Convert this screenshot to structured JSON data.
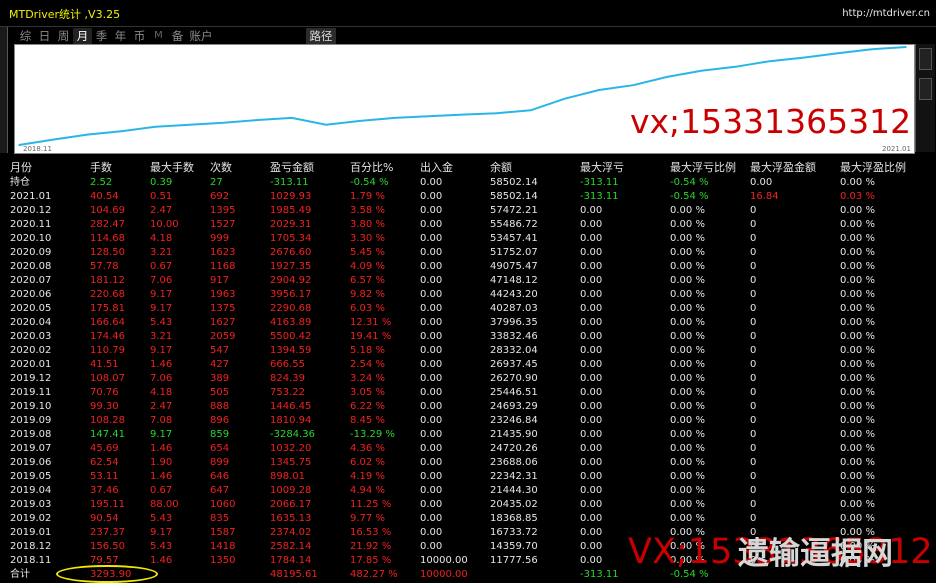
{
  "app": {
    "title": "MTDriver统计 ,V3.25",
    "url": "http://mtdriver.cn"
  },
  "tabs": [
    {
      "label": "综",
      "active": false
    },
    {
      "label": "日",
      "active": false
    },
    {
      "label": "周",
      "active": false
    },
    {
      "label": "月",
      "active": true
    },
    {
      "label": "季",
      "active": false
    },
    {
      "label": "年",
      "active": false
    },
    {
      "label": "币",
      "active": false
    },
    {
      "label": "M",
      "active": false
    },
    {
      "label": "备",
      "active": false
    },
    {
      "label": "账户",
      "active": false
    }
  ],
  "route_button": "路径",
  "chart_data": {
    "type": "line",
    "xlabel_start": "2018.11",
    "xlabel_end": "2021.01",
    "line_color": "#29b6e6",
    "x": [
      "2018.11",
      "2018.12",
      "2019.01",
      "2019.02",
      "2019.03",
      "2019.04",
      "2019.05",
      "2019.06",
      "2019.07",
      "2019.08",
      "2019.09",
      "2019.10",
      "2019.11",
      "2019.12",
      "2020.01",
      "2020.02",
      "2020.03",
      "2020.04",
      "2020.05",
      "2020.06",
      "2020.07",
      "2020.08",
      "2020.09",
      "2020.10",
      "2020.11",
      "2020.12",
      "2021.01"
    ],
    "values": [
      11777.56,
      14359.7,
      16733.72,
      18368.85,
      20435.02,
      21444.3,
      22342.31,
      23688.06,
      24720.26,
      21435.9,
      23246.84,
      24693.29,
      25446.51,
      26270.9,
      26937.45,
      28332.04,
      33832.46,
      37996.35,
      40287.03,
      44243.2,
      47148.12,
      49075.47,
      51752.07,
      53457.41,
      55486.72,
      57472.21,
      58502.14
    ]
  },
  "watermarks": {
    "top": "vx;15331365312",
    "bottom_red": "VX;15331365312",
    "bottom_white": "遗输逼据网"
  },
  "columns": [
    "月份",
    "手数",
    "最大手数",
    "次数",
    "盈亏金额",
    "百分比%",
    "出入金",
    "余额",
    "最大浮亏",
    "最大浮亏比例",
    "最大浮盈金额",
    "最大浮盈比例"
  ],
  "rows": [
    {
      "m": "持仓",
      "lots": "2.52",
      "maxlots": "0.39",
      "count": "27",
      "pl": "-313.11",
      "pct": "-0.54 %",
      "dep": "0.00",
      "bal": "58502.14",
      "mfl": "-313.11",
      "mflp": "-0.54 %",
      "mfp": "0.00",
      "mfpp": "0.00 %",
      "color": "green"
    },
    {
      "m": "2021.01",
      "lots": "40.54",
      "maxlots": "0.51",
      "count": "692",
      "pl": "1029.93",
      "pct": "1.79 %",
      "dep": "0.00",
      "bal": "58502.14",
      "mfl": "-313.11",
      "mflp": "-0.54 %",
      "mfp": "16.84",
      "mfpp": "0.03 %",
      "color": "red"
    },
    {
      "m": "2020.12",
      "lots": "104.69",
      "maxlots": "2.47",
      "count": "1395",
      "pl": "1985.49",
      "pct": "3.58 %",
      "dep": "0.00",
      "bal": "57472.21",
      "mfl": "0.00",
      "mflp": "0.00 %",
      "mfp": "0",
      "mfpp": "0.00 %",
      "color": "red"
    },
    {
      "m": "2020.11",
      "lots": "282.47",
      "maxlots": "10.00",
      "count": "1527",
      "pl": "2029.31",
      "pct": "3.80 %",
      "dep": "0.00",
      "bal": "55486.72",
      "mfl": "0.00",
      "mflp": "0.00 %",
      "mfp": "0",
      "mfpp": "0.00 %",
      "color": "red"
    },
    {
      "m": "2020.10",
      "lots": "114.68",
      "maxlots": "4.18",
      "count": "999",
      "pl": "1705.34",
      "pct": "3.30 %",
      "dep": "0.00",
      "bal": "53457.41",
      "mfl": "0.00",
      "mflp": "0.00 %",
      "mfp": "0",
      "mfpp": "0.00 %",
      "color": "red"
    },
    {
      "m": "2020.09",
      "lots": "128.50",
      "maxlots": "3.21",
      "count": "1623",
      "pl": "2676.60",
      "pct": "5.45 %",
      "dep": "0.00",
      "bal": "51752.07",
      "mfl": "0.00",
      "mflp": "0.00 %",
      "mfp": "0",
      "mfpp": "0.00 %",
      "color": "red"
    },
    {
      "m": "2020.08",
      "lots": "57.78",
      "maxlots": "0.67",
      "count": "1168",
      "pl": "1927.35",
      "pct": "4.09 %",
      "dep": "0.00",
      "bal": "49075.47",
      "mfl": "0.00",
      "mflp": "0.00 %",
      "mfp": "0",
      "mfpp": "0.00 %",
      "color": "red"
    },
    {
      "m": "2020.07",
      "lots": "181.12",
      "maxlots": "7.06",
      "count": "917",
      "pl": "2904.92",
      "pct": "6.57 %",
      "dep": "0.00",
      "bal": "47148.12",
      "mfl": "0.00",
      "mflp": "0.00 %",
      "mfp": "0",
      "mfpp": "0.00 %",
      "color": "red"
    },
    {
      "m": "2020.06",
      "lots": "220.68",
      "maxlots": "9.17",
      "count": "1963",
      "pl": "3956.17",
      "pct": "9.82 %",
      "dep": "0.00",
      "bal": "44243.20",
      "mfl": "0.00",
      "mflp": "0.00 %",
      "mfp": "0",
      "mfpp": "0.00 %",
      "color": "red"
    },
    {
      "m": "2020.05",
      "lots": "175.81",
      "maxlots": "9.17",
      "count": "1375",
      "pl": "2290.68",
      "pct": "6.03 %",
      "dep": "0.00",
      "bal": "40287.03",
      "mfl": "0.00",
      "mflp": "0.00 %",
      "mfp": "0",
      "mfpp": "0.00 %",
      "color": "red"
    },
    {
      "m": "2020.04",
      "lots": "166.64",
      "maxlots": "5.43",
      "count": "1627",
      "pl": "4163.89",
      "pct": "12.31 %",
      "dep": "0.00",
      "bal": "37996.35",
      "mfl": "0.00",
      "mflp": "0.00 %",
      "mfp": "0",
      "mfpp": "0.00 %",
      "color": "red"
    },
    {
      "m": "2020.03",
      "lots": "174.46",
      "maxlots": "3.21",
      "count": "2059",
      "pl": "5500.42",
      "pct": "19.41 %",
      "dep": "0.00",
      "bal": "33832.46",
      "mfl": "0.00",
      "mflp": "0.00 %",
      "mfp": "0",
      "mfpp": "0.00 %",
      "color": "red"
    },
    {
      "m": "2020.02",
      "lots": "110.79",
      "maxlots": "9.17",
      "count": "547",
      "pl": "1394.59",
      "pct": "5.18 %",
      "dep": "0.00",
      "bal": "28332.04",
      "mfl": "0.00",
      "mflp": "0.00 %",
      "mfp": "0",
      "mfpp": "0.00 %",
      "color": "red"
    },
    {
      "m": "2020.01",
      "lots": "41.51",
      "maxlots": "1.46",
      "count": "427",
      "pl": "666.55",
      "pct": "2.54 %",
      "dep": "0.00",
      "bal": "26937.45",
      "mfl": "0.00",
      "mflp": "0.00 %",
      "mfp": "0",
      "mfpp": "0.00 %",
      "color": "red"
    },
    {
      "m": "2019.12",
      "lots": "108.07",
      "maxlots": "7.06",
      "count": "389",
      "pl": "824.39",
      "pct": "3.24 %",
      "dep": "0.00",
      "bal": "26270.90",
      "mfl": "0.00",
      "mflp": "0.00 %",
      "mfp": "0",
      "mfpp": "0.00 %",
      "color": "red"
    },
    {
      "m": "2019.11",
      "lots": "70.76",
      "maxlots": "4.18",
      "count": "505",
      "pl": "753.22",
      "pct": "3.05 %",
      "dep": "0.00",
      "bal": "25446.51",
      "mfl": "0.00",
      "mflp": "0.00 %",
      "mfp": "0",
      "mfpp": "0.00 %",
      "color": "red"
    },
    {
      "m": "2019.10",
      "lots": "99.30",
      "maxlots": "2.47",
      "count": "888",
      "pl": "1446.45",
      "pct": "6.22 %",
      "dep": "0.00",
      "bal": "24693.29",
      "mfl": "0.00",
      "mflp": "0.00 %",
      "mfp": "0",
      "mfpp": "0.00 %",
      "color": "red"
    },
    {
      "m": "2019.09",
      "lots": "108.28",
      "maxlots": "7.08",
      "count": "896",
      "pl": "1810.94",
      "pct": "8.45 %",
      "dep": "0.00",
      "bal": "23246.84",
      "mfl": "0.00",
      "mflp": "0.00 %",
      "mfp": "0",
      "mfpp": "0.00 %",
      "color": "red"
    },
    {
      "m": "2019.08",
      "lots": "147.41",
      "maxlots": "9.17",
      "count": "859",
      "pl": "-3284.36",
      "pct": "-13.29 %",
      "dep": "0.00",
      "bal": "21435.90",
      "mfl": "0.00",
      "mflp": "0.00 %",
      "mfp": "0",
      "mfpp": "0.00 %",
      "color": "green"
    },
    {
      "m": "2019.07",
      "lots": "45.69",
      "maxlots": "1.46",
      "count": "654",
      "pl": "1032.20",
      "pct": "4.36 %",
      "dep": "0.00",
      "bal": "24720.26",
      "mfl": "0.00",
      "mflp": "0.00 %",
      "mfp": "0",
      "mfpp": "0.00 %",
      "color": "red"
    },
    {
      "m": "2019.06",
      "lots": "62.54",
      "maxlots": "1.90",
      "count": "899",
      "pl": "1345.75",
      "pct": "6.02 %",
      "dep": "0.00",
      "bal": "23688.06",
      "mfl": "0.00",
      "mflp": "0.00 %",
      "mfp": "0",
      "mfpp": "0.00 %",
      "color": "red"
    },
    {
      "m": "2019.05",
      "lots": "53.11",
      "maxlots": "1.46",
      "count": "646",
      "pl": "898.01",
      "pct": "4.19 %",
      "dep": "0.00",
      "bal": "22342.31",
      "mfl": "0.00",
      "mflp": "0.00 %",
      "mfp": "0",
      "mfpp": "0.00 %",
      "color": "red"
    },
    {
      "m": "2019.04",
      "lots": "37.46",
      "maxlots": "0.67",
      "count": "647",
      "pl": "1009.28",
      "pct": "4.94 %",
      "dep": "0.00",
      "bal": "21444.30",
      "mfl": "0.00",
      "mflp": "0.00 %",
      "mfp": "0",
      "mfpp": "0.00 %",
      "color": "red"
    },
    {
      "m": "2019.03",
      "lots": "195.11",
      "maxlots": "88.00",
      "count": "1060",
      "pl": "2066.17",
      "pct": "11.25 %",
      "dep": "0.00",
      "bal": "20435.02",
      "mfl": "0.00",
      "mflp": "0.00 %",
      "mfp": "0",
      "mfpp": "0.00 %",
      "color": "red"
    },
    {
      "m": "2019.02",
      "lots": "90.54",
      "maxlots": "5.43",
      "count": "835",
      "pl": "1635.13",
      "pct": "9.77 %",
      "dep": "0.00",
      "bal": "18368.85",
      "mfl": "0.00",
      "mflp": "0.00 %",
      "mfp": "0",
      "mfpp": "0.00 %",
      "color": "red"
    },
    {
      "m": "2019.01",
      "lots": "237.37",
      "maxlots": "9.17",
      "count": "1587",
      "pl": "2374.02",
      "pct": "16.53 %",
      "dep": "0.00",
      "bal": "16733.72",
      "mfl": "0.00",
      "mflp": "0.00 %",
      "mfp": "0",
      "mfpp": "0.00 %",
      "color": "red"
    },
    {
      "m": "2018.12",
      "lots": "156.50",
      "maxlots": "5.43",
      "count": "1418",
      "pl": "2582.14",
      "pct": "21.92 %",
      "dep": "0.00",
      "bal": "14359.70",
      "mfl": "0.00",
      "mflp": "0.00 %",
      "mfp": "0",
      "mfpp": "0.00 %",
      "color": "red"
    },
    {
      "m": "2018.11",
      "lots": "79.57",
      "maxlots": "1.46",
      "count": "1350",
      "pl": "1784.14",
      "pct": "17.85 %",
      "dep": "10000.00",
      "bal": "11777.56",
      "mfl": "0.00",
      "mflp": "0.00 %",
      "mfp": "0",
      "mfpp": "0.00 %",
      "color": "red"
    },
    {
      "m": "合计",
      "lots": "3293.90",
      "maxlots": "",
      "count": "",
      "pl": "48195.61",
      "pct": "482.27 %",
      "dep": "10000.00",
      "bal": "",
      "mfl": "-313.11",
      "mflp": "-0.54 %",
      "mfp": "",
      "mfpp": "",
      "color": "red"
    }
  ]
}
